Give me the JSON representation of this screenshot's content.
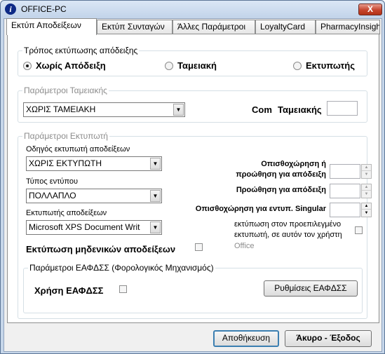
{
  "window": {
    "title": "OFFICE-PC",
    "info_icon_glyph": "i",
    "close_glyph": "X"
  },
  "tabs": [
    {
      "label": "Εκτύπ Αποδείξεων",
      "active": true
    },
    {
      "label": "Εκτύπ Συνταγών",
      "active": false
    },
    {
      "label": "Άλλες Παράμετροι",
      "active": false
    },
    {
      "label": "LoyaltyCard",
      "active": false
    },
    {
      "label": "PharmacyInsight",
      "active": false
    }
  ],
  "print_mode": {
    "title": "Τρόπος εκτύπωσης απόδειξης",
    "options": [
      {
        "label": "Χωρίς Απόδειξη",
        "selected": true
      },
      {
        "label": "Ταμειακή",
        "selected": false
      },
      {
        "label": "Εκτυπωτής",
        "selected": false
      }
    ]
  },
  "cash_register": {
    "title": "Παράμετροι Ταμειακής",
    "select_value": "ΧΩΡΙΣ ΤΑΜΕΙΑΚΗ",
    "com_label": "Com",
    "register_label": "Ταμειακής",
    "com_value": ""
  },
  "printer": {
    "title": "Παράμετροι Εκτυπωτή",
    "driver_label": "Οδηγός εκτυπωτή αποδείξεων",
    "driver_value": "ΧΩΡΙΣ ΕΚΤΥΠΩΤΗ",
    "form_label": "Τύπος εντύπου",
    "form_value": "ΠΟΛΛΑΠΛΟ",
    "receipt_printer_label": "Εκτυπωτής αποδείξεων",
    "receipt_printer_value": "Microsoft XPS Document Writ",
    "backfeed_line1": "Οπισθοχώρηση ή",
    "backfeed_line2": "προώθηση για απόδειξη",
    "forward_label": "Προώθηση για απόδειξη",
    "singular_label": "Οπισθοχώρηση για εντυπ. Singular",
    "default_printer_line1": "εκτύπωση στον προεπιλεγμένο",
    "default_printer_line2": "εκτυπωτή, σε αυτόν τον χρήστη",
    "default_printer_line3": "Office",
    "zero_receipts_label": "Εκτύπωση μηδενικών αποδείξεων",
    "zero_receipts_checked": false,
    "default_printer_checked": false
  },
  "eafdss": {
    "title": "Παράμετροι ΕΑΦΔΣΣ (Φορολογικός Μηχανισμός)",
    "use_label": "Χρήση ΕΑΦΔΣΣ",
    "use_checked": false,
    "settings_button": "Ρυθμίσεις ΕΑΦΔΣΣ"
  },
  "footer": {
    "save_button": "Αποθήκευση",
    "cancel_button": "Άκυρο - Έξοδος"
  },
  "icons": {
    "dropdown": "▼",
    "spin_up": "▲",
    "spin_down": "▼"
  }
}
